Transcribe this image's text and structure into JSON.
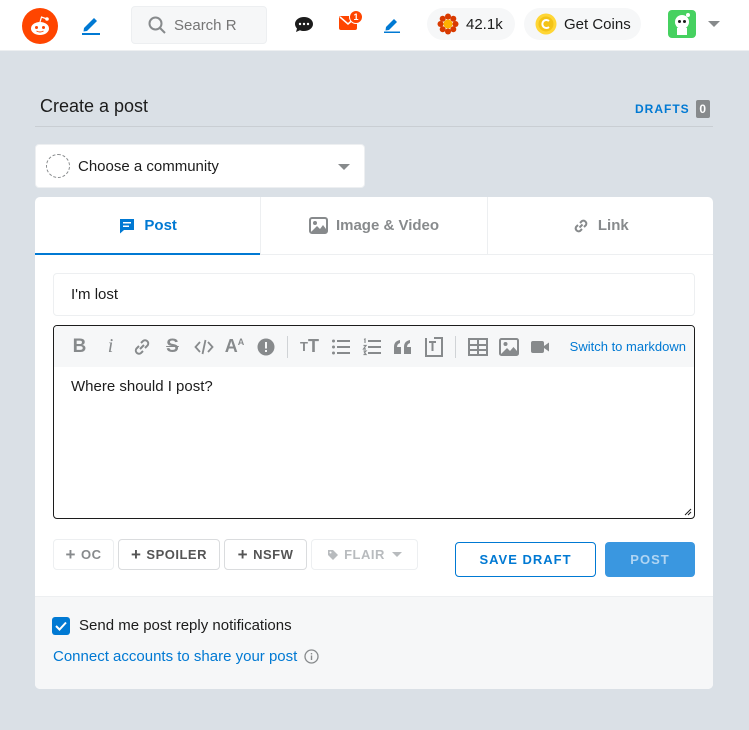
{
  "topbar": {
    "search_placeholder": "Search R",
    "mail_badge": "1",
    "karma": "42.1k",
    "coins_label": "Get Coins"
  },
  "page": {
    "title": "Create a post",
    "drafts_label": "DRAFTS",
    "drafts_count": "0"
  },
  "community": {
    "placeholder": "Choose a community"
  },
  "tabs": [
    {
      "label": "Post",
      "icon": "post-icon",
      "active": true
    },
    {
      "label": "Image & Video",
      "icon": "image-icon",
      "active": false
    },
    {
      "label": "Link",
      "icon": "link-icon",
      "active": false
    }
  ],
  "form": {
    "title_value": "I'm lost",
    "body_value": "Where should I post?",
    "markdown_toggle": "Switch to markdown"
  },
  "tags": {
    "oc": "OC",
    "spoiler": "SPOILER",
    "nsfw": "NSFW",
    "flair": "FLAIR"
  },
  "actions": {
    "save_draft": "SAVE DRAFT",
    "post": "POST"
  },
  "footer": {
    "notifications_label": "Send me post reply notifications",
    "notifications_checked": true,
    "connect_label": "Connect accounts to share your post"
  },
  "colors": {
    "brand": "#ff4500",
    "accent": "#0079d3",
    "page_bg": "#dae0e6"
  }
}
